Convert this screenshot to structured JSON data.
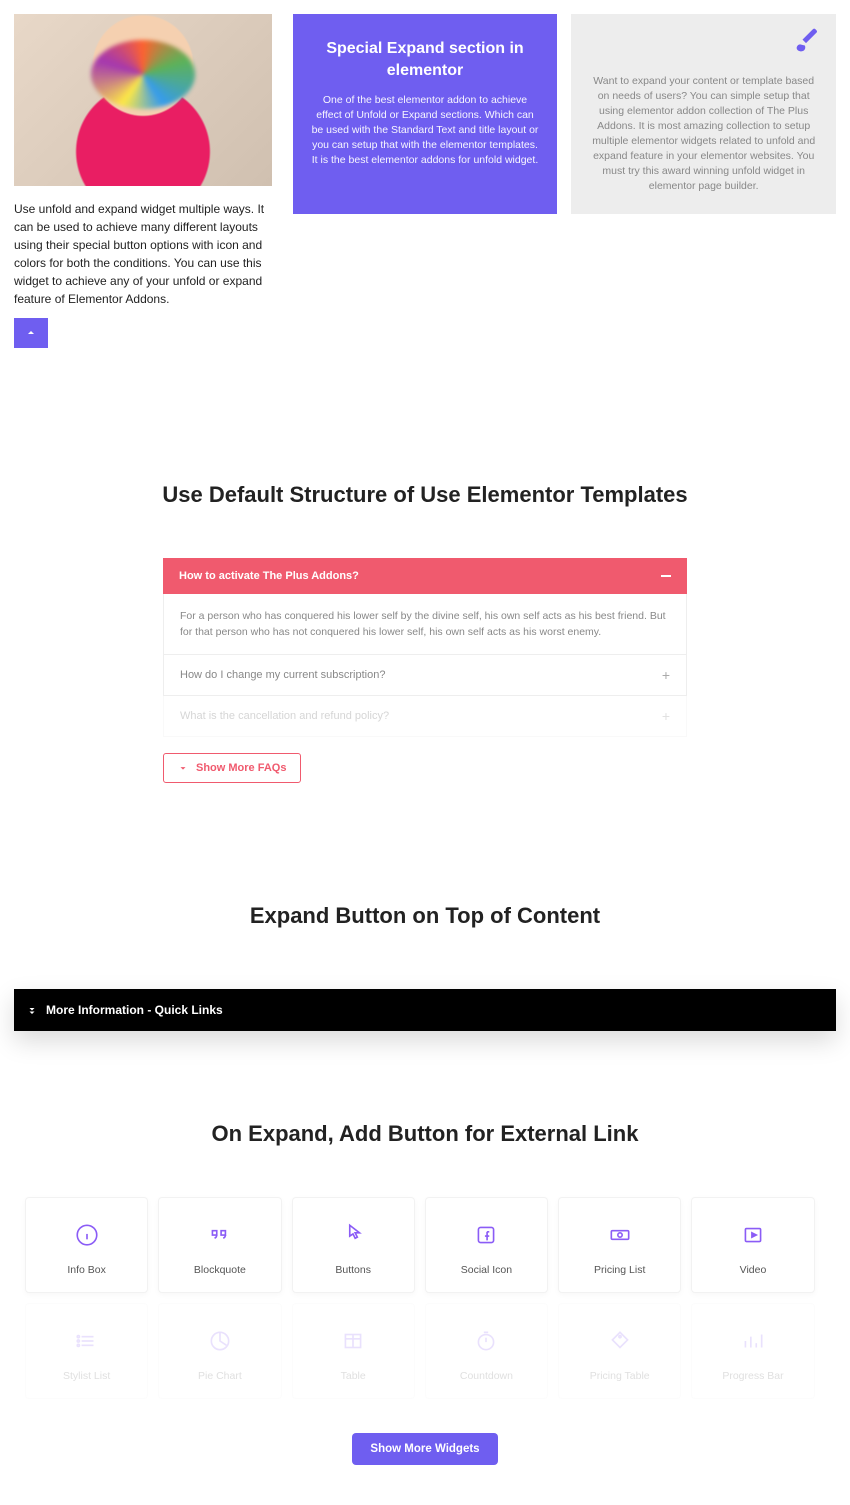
{
  "col1": {
    "desc": "Use unfold and expand widget multiple ways. It can be used to achieve many different layouts using their special button options with icon and colors for both the conditions. You can use this widget to achieve any of your unfold or expand feature of Elementor Addons."
  },
  "col2": {
    "title": "Special Expand section in elementor",
    "body": "One of the best elementor addon to achieve effect of Unfold or Expand sections. Which can be used with the Standard Text and title layout or you can setup that with the elementor templates. It is the best elementor addons for unfold widget."
  },
  "col3": {
    "body": "Want to expand your content or template based on needs of users? You can simple setup that using elementor addon collection of The Plus Addons. It is most amazing collection to setup multiple elementor widgets related to unfold and expand feature in your elementor websites. You must try this award winning unfold widget in elementor page builder."
  },
  "section1_title": "Use Default Structure of Use Elementor Templates",
  "faq": {
    "open": {
      "q": "How to activate The Plus Addons?",
      "a": "For a person who has conquered his lower self by the divine self, his own self acts as his best friend. But for that person who has not conquered his lower self, his own self acts as his worst enemy."
    },
    "items": [
      "How do I change my current subscription?",
      "What is the cancellation and refund policy?"
    ],
    "show_more": "Show More FAQs"
  },
  "section2_title": "Expand Button on Top of Content",
  "blackbar": "More Information - Quick Links",
  "section3_title": "On Expand, Add Button for External Link",
  "widgets": [
    {
      "label": "Info Box",
      "icon": "info"
    },
    {
      "label": "Blockquote",
      "icon": "quote"
    },
    {
      "label": "Buttons",
      "icon": "pointer"
    },
    {
      "label": "Social Icon",
      "icon": "fb"
    },
    {
      "label": "Pricing List",
      "icon": "money"
    },
    {
      "label": "Video",
      "icon": "video"
    },
    {
      "label": "Stylist List",
      "icon": "list"
    },
    {
      "label": "Pie Chart",
      "icon": "pie"
    },
    {
      "label": "Table",
      "icon": "table"
    },
    {
      "label": "Countdown",
      "icon": "timer"
    },
    {
      "label": "Pricing Table",
      "icon": "tag"
    },
    {
      "label": "Progress Bar",
      "icon": "bar"
    }
  ],
  "show_widgets": "Show More Widgets"
}
